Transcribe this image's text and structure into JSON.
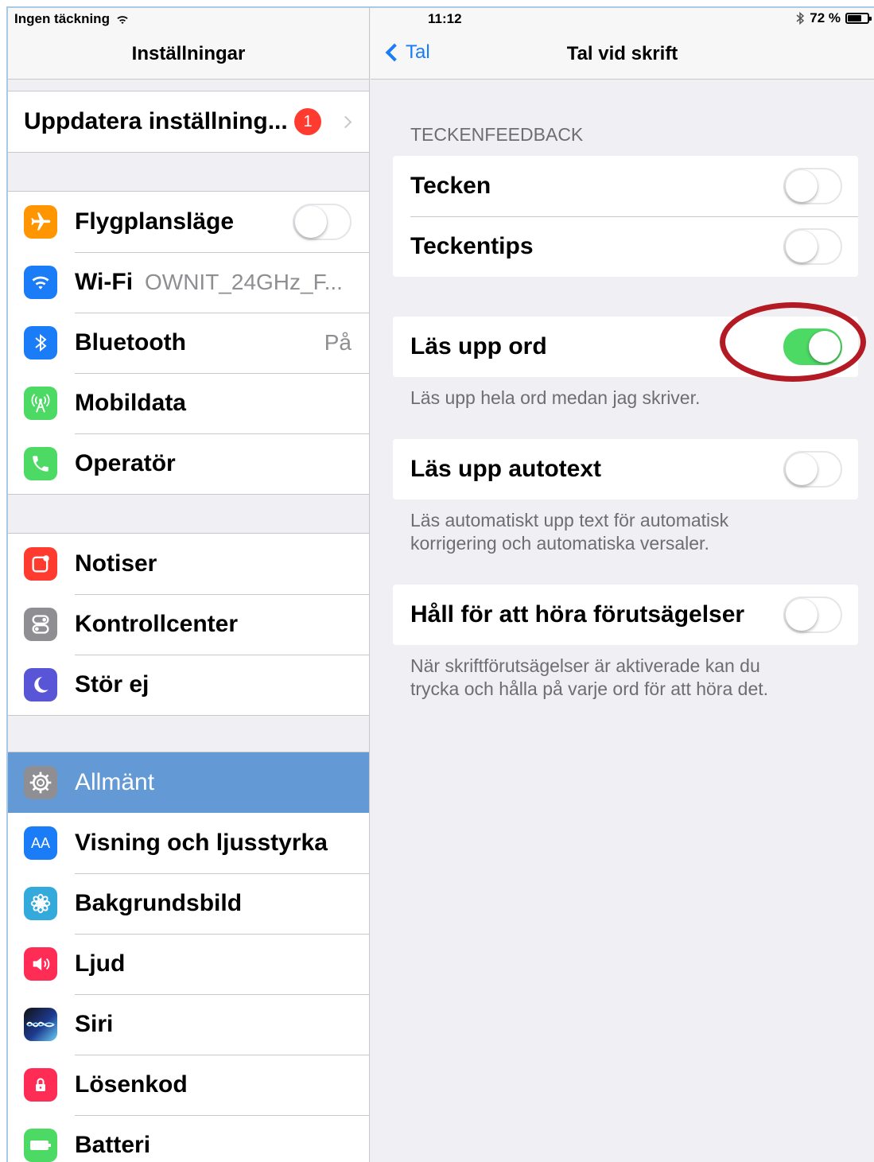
{
  "status_bar": {
    "carrier": "Ingen täckning",
    "time": "11:12",
    "battery": "72 %",
    "battery_level": 0.72
  },
  "master": {
    "title": "Inställningar",
    "update": {
      "label": "Uppdatera inställning...",
      "badge": "1"
    },
    "group1": [
      {
        "label": "Flygplansläge",
        "icon": "airplane-icon",
        "color": "#ff9500",
        "toggle": false
      },
      {
        "label": "Wi-Fi",
        "value": "OWNIT_24GHz_F...",
        "icon": "wifi-icon",
        "color": "#1a7cf7"
      },
      {
        "label": "Bluetooth",
        "value": "På",
        "icon": "bluetooth-icon",
        "color": "#1a7cf7"
      },
      {
        "label": "Mobildata",
        "icon": "antenna-icon",
        "color": "#4cd964"
      },
      {
        "label": "Operatör",
        "icon": "phone-icon",
        "color": "#4cd964"
      }
    ],
    "group2": [
      {
        "label": "Notiser",
        "icon": "notifications-icon",
        "color": "#ff3b30"
      },
      {
        "label": "Kontrollcenter",
        "icon": "control-center-icon",
        "color": "#8e8e93"
      },
      {
        "label": "Stör ej",
        "icon": "moon-icon",
        "color": "#5856d6"
      }
    ],
    "group3": [
      {
        "label": "Allmänt",
        "icon": "gear-icon",
        "color": "#8e8e93",
        "selected": true
      },
      {
        "label": "Visning och ljusstyrka",
        "icon": "text-size-icon",
        "color": "#1a7cf7",
        "glyph": "AA"
      },
      {
        "label": "Bakgrundsbild",
        "icon": "flower-icon",
        "color": "#34aadc"
      },
      {
        "label": "Ljud",
        "icon": "speaker-icon",
        "color": "#ff2d55"
      },
      {
        "label": "Siri",
        "icon": "siri-icon",
        "color": "#1d3a8f"
      },
      {
        "label": "Lösenkod",
        "icon": "lock-icon",
        "color": "#ff2d55"
      },
      {
        "label": "Batteri",
        "icon": "battery-icon",
        "color": "#4cd964"
      }
    ]
  },
  "detail": {
    "back_label": "Tal",
    "title": "Tal vid skrift",
    "section_header": "TECKENFEEDBACK",
    "char_rows": [
      {
        "label": "Tecken",
        "toggle": false
      },
      {
        "label": "Teckentips",
        "toggle": false
      }
    ],
    "speak_words": {
      "label": "Läs upp ord",
      "toggle": true,
      "footer": "Läs upp hela ord medan jag skriver."
    },
    "speak_autotext": {
      "label": "Läs upp autotext",
      "toggle": false,
      "footer_line1": "Läs automatiskt upp text för automatisk",
      "footer_line2": "korrigering och automatiska versaler."
    },
    "hold_predictions": {
      "label": "Håll för att höra förutsägelser",
      "toggle": false,
      "footer_line1": "När skriftförutsägelser är aktiverade kan du",
      "footer_line2": "trycka och hålla på varje ord för att höra det."
    }
  }
}
